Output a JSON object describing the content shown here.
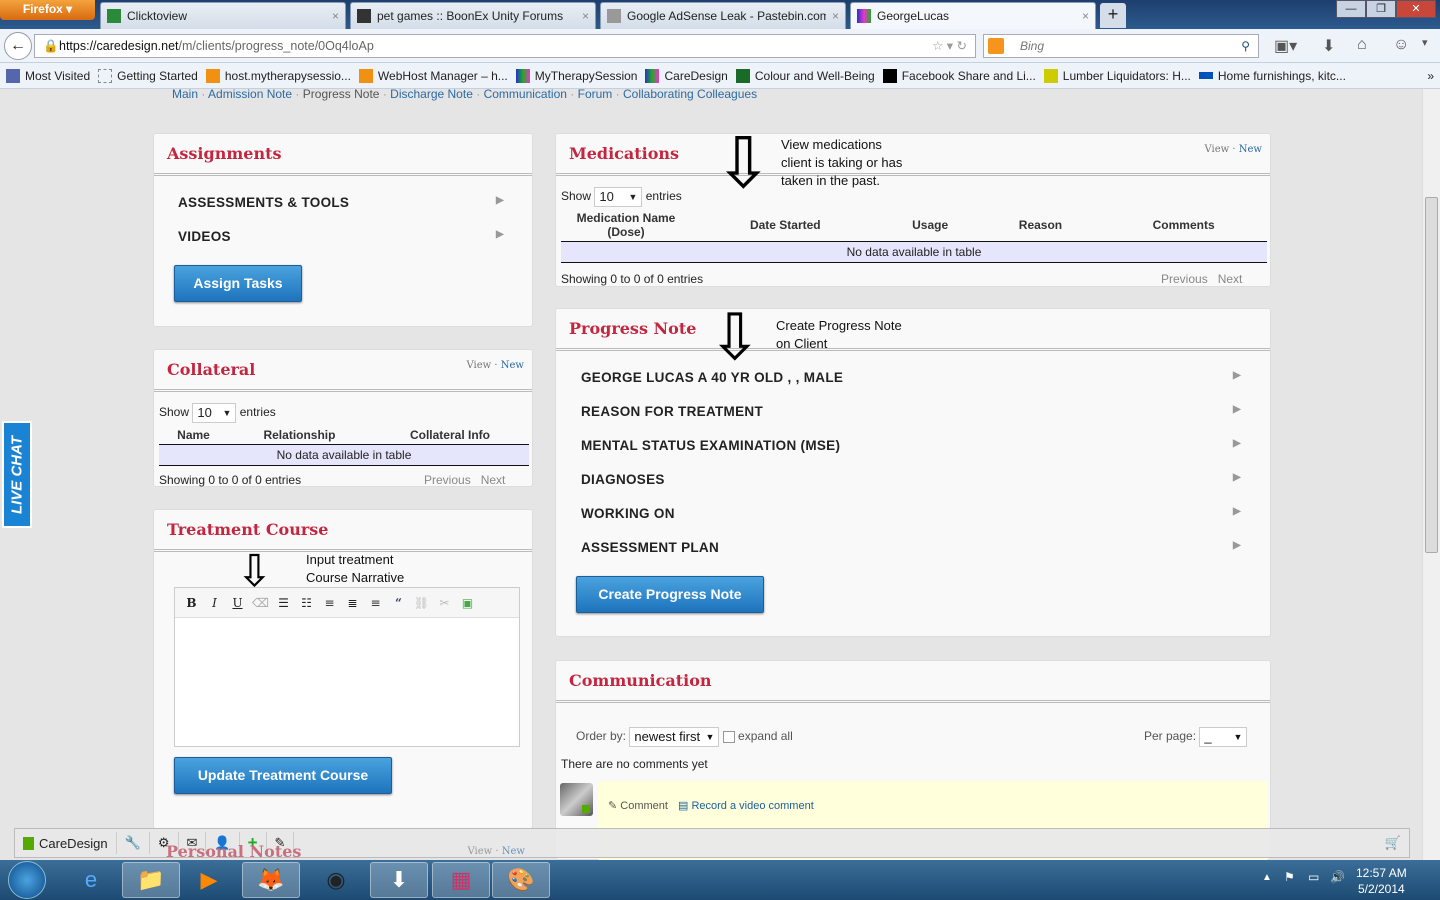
{
  "browser": {
    "menu_label": "Firefox",
    "tabs": [
      {
        "title": "Clicktoview"
      },
      {
        "title": "pet games :: BoonEx Unity Forums"
      },
      {
        "title": "Google AdSense Leak - Pastebin.com"
      },
      {
        "title": "GeorgeLucas",
        "active": true
      }
    ],
    "new_tab": "+",
    "url_domain": "https://caredesign.net",
    "url_path": "/m/clients/progress_note/0Oq4loAp",
    "search_placeholder": "Bing",
    "bookmarks": [
      "Most Visited",
      "Getting Started",
      "host.mytherapysessio...",
      "WebHost Manager – h...",
      "MyTherapySession",
      "CareDesign",
      "Colour and Well-Being",
      "Facebook Share and Li...",
      "Lumber Liquidators: H...",
      "Home furnishings, kitc..."
    ],
    "bookmarks_overflow": "»"
  },
  "page": {
    "top_links": [
      "Main",
      "Admission Note",
      "Progress Note",
      "Discharge Note",
      "Communication",
      "Forum",
      "Collaborating Colleagues"
    ],
    "assignments": {
      "title": "Assignments",
      "items": [
        "ASSESSMENTS & TOOLS",
        "VIDEOS"
      ],
      "button": "Assign Tasks"
    },
    "collateral": {
      "title": "Collateral",
      "view": "View",
      "new": "New",
      "show": "Show",
      "page_size": "10",
      "entries": "entries",
      "columns": [
        "Name",
        "Relationship",
        "Collateral Info"
      ],
      "empty": "No data available in table",
      "info": "Showing 0 to 0 of 0 entries",
      "previous": "Previous",
      "next": "Next"
    },
    "treatment": {
      "title": "Treatment Course",
      "annotation": [
        "Input treatment",
        "Course Narrative"
      ],
      "toolbar": [
        "B",
        "I",
        "U",
        "⌫",
        "☰",
        "☷",
        "≡",
        "≣",
        "≡",
        "“",
        "⛓",
        "✂",
        "▣"
      ],
      "button": "Update Treatment Course"
    },
    "medications": {
      "title": "Medications",
      "annotation": [
        "View medications",
        "client is taking or has",
        "taken in the past."
      ],
      "view": "View",
      "new": "New",
      "show": "Show",
      "page_size": "10",
      "entries": "entries",
      "columns": [
        "Medication Name (Dose)",
        "Date Started",
        "Usage",
        "Reason",
        "Comments"
      ],
      "empty": "No data available in table",
      "info": "Showing 0 to 0 of 0 entries",
      "previous": "Previous",
      "next": "Next"
    },
    "progress": {
      "title": "Progress Note",
      "annotation": [
        "Create Progress Note",
        "on Client"
      ],
      "items": [
        "GEORGE LUCAS A 40 YR OLD , , MALE",
        "REASON FOR TREATMENT",
        "MENTAL STATUS EXAMINATION (MSE)",
        "DIAGNOSES",
        "WORKING ON",
        "ASSESSMENT PLAN"
      ],
      "button": "Create Progress Note"
    },
    "communication": {
      "title": "Communication",
      "order_label": "Order by:",
      "order_value": "newest first",
      "expand_all": "expand all",
      "per_page_label": "Per page:",
      "per_page_value": "_",
      "no_comments": "There are no comments yet",
      "comment": "Comment",
      "record_video": "Record a video comment"
    },
    "personal_notes": {
      "title": "Personal Notes",
      "view": "View",
      "new": "New"
    },
    "live_chat": "LIVE CHAT"
  },
  "bottom_bar": {
    "brand": "CareDesign"
  },
  "taskbar": {
    "time": "12:57 AM",
    "date": "5/2/2014"
  }
}
